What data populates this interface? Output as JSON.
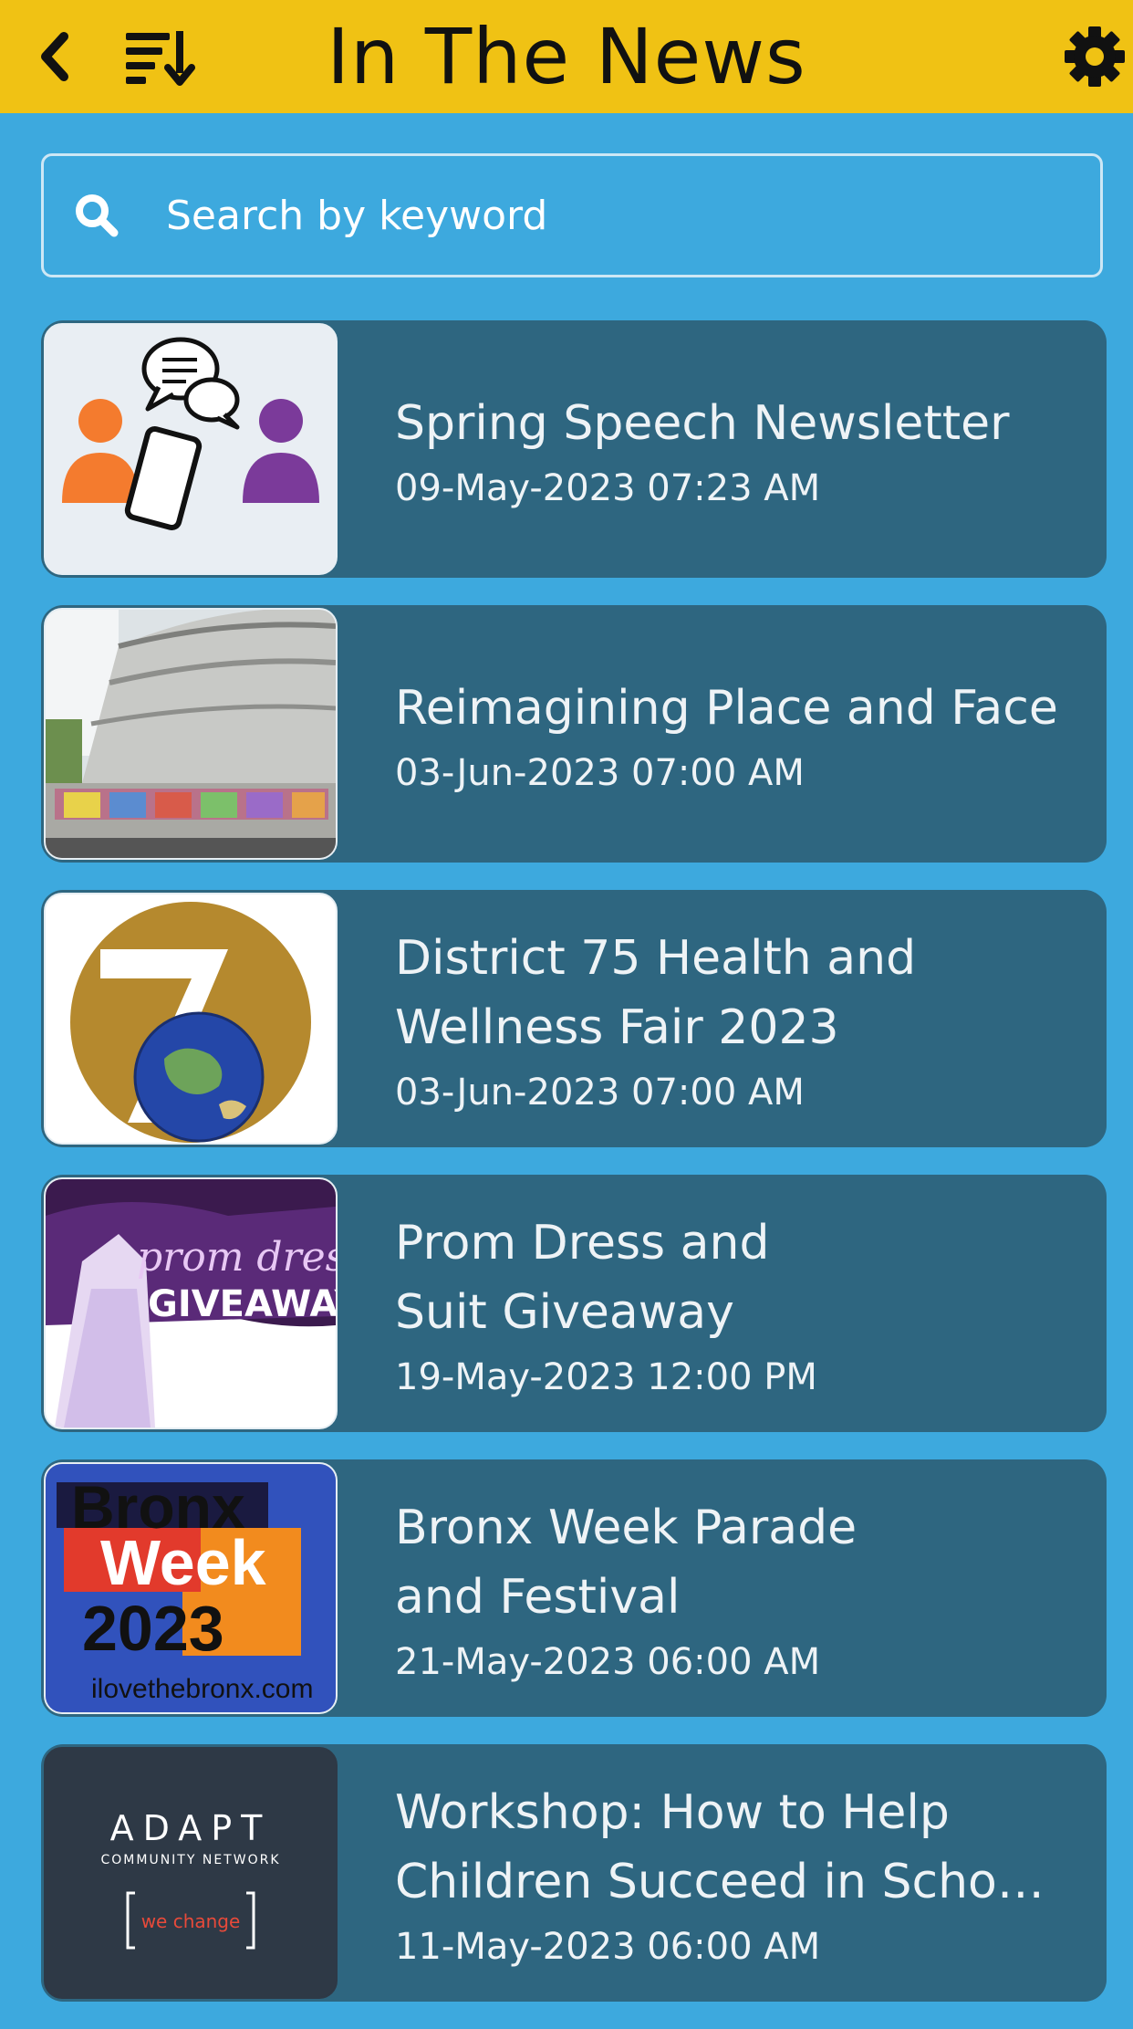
{
  "header": {
    "title": "In The News",
    "back_icon": "chevron-left-icon",
    "sort_icon": "sort-descending-icon",
    "settings_icon": "gear-icon"
  },
  "search": {
    "placeholder": "Search by keyword",
    "icon": "search-icon"
  },
  "items": [
    {
      "title": "Spring Speech Newsletter",
      "date": "09-May-2023 07:23 AM",
      "thumb": "speech-chat-image"
    },
    {
      "title": "Reimagining Place and Face",
      "date": "03-Jun-2023 07:00 AM",
      "thumb": "museum-photo"
    },
    {
      "title": "District 75 Health and\nWellness Fair 2023",
      "date": "03-Jun-2023 07:00 AM",
      "thumb": "district-75-logo"
    },
    {
      "title": "Prom Dress and\nSuit Giveaway",
      "date": "19-May-2023 12:00 PM",
      "thumb": "prom-dress-giveaway",
      "thumb_text": {
        "line1": "prom dress",
        "line2": "GIVEAWAY"
      }
    },
    {
      "title": "Bronx Week Parade\nand Festival",
      "date": "21-May-2023 06:00 AM",
      "thumb": "bronx-week-logo",
      "thumb_text": {
        "line1": "Bronx",
        "line2": "Week",
        "line3": "2023",
        "line4": "ilovethebronx.com"
      }
    },
    {
      "title": "Workshop: How to Help\nChildren Succeed in Scho…",
      "date": "11-May-2023 06:00 AM",
      "thumb": "adapt-logo",
      "thumb_text": {
        "line1": "ADAPT",
        "line2": "COMMUNITY NETWORK",
        "line3": "we change"
      }
    }
  ],
  "colors": {
    "header_bg": "#F0C214",
    "page_bg": "#3DA9DE",
    "card_bg": "#2E6680",
    "text": "#EEF3F6"
  }
}
